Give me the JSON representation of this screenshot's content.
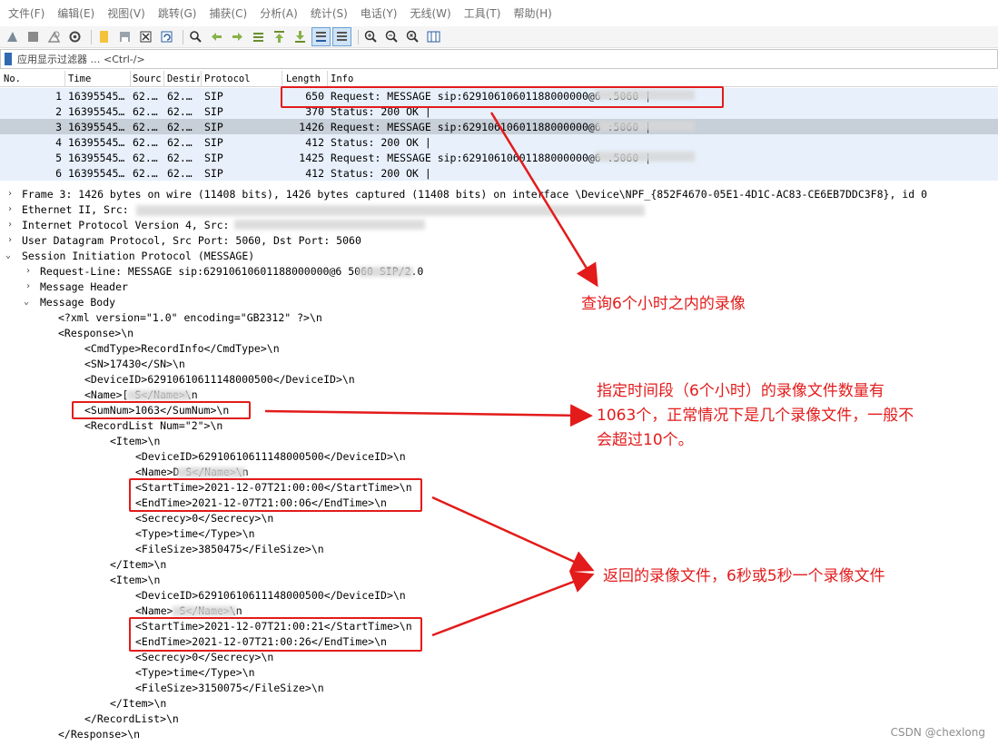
{
  "menu": [
    "文件(F)",
    "编辑(E)",
    "视图(V)",
    "跳转(G)",
    "捕获(C)",
    "分析(A)",
    "统计(S)",
    "电话(Y)",
    "无线(W)",
    "工具(T)",
    "帮助(H)"
  ],
  "toolbar_icons": [
    "shark-fin-start-icon",
    "stop-icon",
    "restart-icon",
    "options-gear-icon",
    "open-file-icon",
    "save-file-icon",
    "close-file-icon",
    "reload-icon",
    "find-icon",
    "go-back-icon",
    "go-forward-icon",
    "go-to-packet-icon",
    "first-packet-icon",
    "last-packet-icon",
    "autoscroll-icon",
    "colorize-icon",
    "zoom-in-icon",
    "zoom-out-icon",
    "zoom-reset-icon",
    "resize-columns-icon"
  ],
  "filter": {
    "label": "应用显示过滤器 … <Ctrl-/>"
  },
  "packet_list": {
    "columns": [
      "No.",
      "Time",
      "Sourc",
      "Destir",
      "Protocol",
      "Length",
      "Info"
    ],
    "rows": [
      {
        "no": "1",
        "time": "16395545…",
        "src": "62.…",
        "dst": "62.…",
        "proto": "SIP",
        "len": "650",
        "info": "Request: MESSAGE sip:62910610601188000000@6        .5060 |"
      },
      {
        "no": "2",
        "time": "16395545…",
        "src": "62.…",
        "dst": "62.…",
        "proto": "SIP",
        "len": "370",
        "info": "Status: 200 OK |"
      },
      {
        "no": "3",
        "time": "16395545…",
        "src": "62.…",
        "dst": "62.…",
        "proto": "SIP",
        "len": "1426",
        "info": "Request: MESSAGE sip:62910610601188000000@6        :5060 |"
      },
      {
        "no": "4",
        "time": "16395545…",
        "src": "62.…",
        "dst": "62.…",
        "proto": "SIP",
        "len": "412",
        "info": "Status: 200 OK |"
      },
      {
        "no": "5",
        "time": "16395545…",
        "src": "62.…",
        "dst": "62.…",
        "proto": "SIP",
        "len": "1425",
        "info": "Request: MESSAGE sip:62910610601188000000@6        .5060 |"
      },
      {
        "no": "6",
        "time": "16395545…",
        "src": "62.…",
        "dst": "62.…",
        "proto": "SIP",
        "len": "412",
        "info": "Status: 200 OK |"
      }
    ]
  },
  "details": {
    "frame": "Frame 3: 1426 bytes on wire (11408 bits), 1426 bytes captured (11408 bits) on interface \\Device\\NPF_{852F4670-05E1-4D1C-AC83-CE6EB7DDC3F8}, id 0",
    "ethernet": "Ethernet II, Src:",
    "ip": "Internet Protocol Version 4, Src:",
    "udp": "User Datagram Protocol, Src Port: 5060, Dst Port: 5060",
    "sip": "Session Initiation Protocol (MESSAGE)",
    "request_line": "Request-Line: MESSAGE sip:62910610601188000000@6        5060 SIP/2.0",
    "message_header": "Message Header",
    "message_body": "Message Body",
    "xml_lines": [
      "<?xml version=\"1.0\" encoding=\"GB2312\" ?>\\n",
      "<Response>\\n",
      "<CmdType>RecordInfo</CmdType>\\n",
      "<SN>17430</SN>\\n",
      "<DeviceID>62910610611148000500</DeviceID>\\n",
      "<Name>[        S</Name>\\n",
      "<SumNum>1063</SumNum>\\n",
      "<RecordList Num=\"2\">\\n",
      "<Item>\\n",
      "<DeviceID>62910610611148000500</DeviceID>\\n",
      "<Name>D        S</Name>\\n",
      "<StartTime>2021-12-07T21:00:00</StartTime>\\n",
      "<EndTime>2021-12-07T21:00:06</EndTime>\\n",
      "<Secrecy>0</Secrecy>\\n",
      "<Type>time</Type>\\n",
      "<FileSize>3850475</FileSize>\\n",
      "</Item>\\n",
      "<Item>\\n",
      "<DeviceID>62910610611148000500</DeviceID>\\n",
      "<Name>        S</Name>\\n",
      "<StartTime>2021-12-07T21:00:21</StartTime>\\n",
      "<EndTime>2021-12-07T21:00:26</EndTime>\\n",
      "<Secrecy>0</Secrecy>\\n",
      "<Type>time</Type>\\n",
      "<FileSize>3150075</FileSize>\\n",
      "</Item>\\n",
      "</RecordList>\\n",
      "</Response>\\n"
    ]
  },
  "annotations": {
    "note1": "查询6个小时之内的录像",
    "note2_line1": "指定时间段（6个小时）的录像文件数量有",
    "note2_line2": "1063个，正常情况下是几个录像文件，一般不",
    "note2_line3": "会超过10个。",
    "note3": "返回的录像文件，6秒或5秒一个录像文件",
    "accent_color": "#e31b1b"
  },
  "watermark": "CSDN @chexlong"
}
